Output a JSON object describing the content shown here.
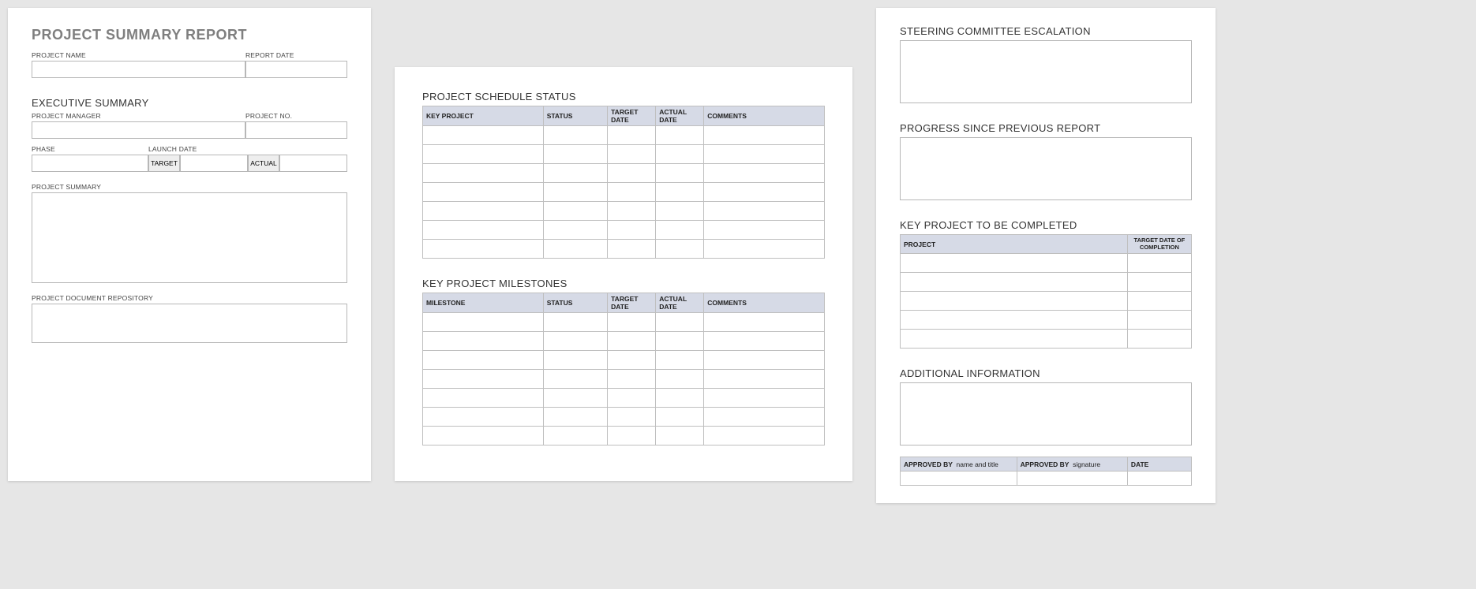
{
  "page1": {
    "title": "PROJECT SUMMARY REPORT",
    "labels": {
      "project_name": "PROJECT NAME",
      "report_date": "REPORT DATE",
      "exec_summary": "EXECUTIVE SUMMARY",
      "project_manager": "PROJECT MANAGER",
      "project_no": "PROJECT NO.",
      "phase": "PHASE",
      "launch_date": "LAUNCH DATE",
      "target": "TARGET",
      "actual": "ACTUAL",
      "project_summary": "PROJECT SUMMARY",
      "doc_repo": "PROJECT DOCUMENT REPOSITORY"
    }
  },
  "page2": {
    "schedule_heading": "PROJECT SCHEDULE STATUS",
    "milestones_heading": "KEY PROJECT MILESTONES",
    "schedule_cols": [
      "KEY PROJECT",
      "STATUS",
      "TARGET DATE",
      "ACTUAL DATE",
      "COMMENTS"
    ],
    "milestone_cols": [
      "MILESTONE",
      "STATUS",
      "TARGET DATE",
      "ACTUAL DATE",
      "COMMENTS"
    ],
    "schedule_rows": 7,
    "milestone_rows": 7
  },
  "page3": {
    "steering_heading": "STEERING COMMITTEE ESCALATION",
    "progress_heading": "PROGRESS SINCE PREVIOUS REPORT",
    "key_project_heading": "KEY PROJECT TO BE COMPLETED",
    "key_project_cols": {
      "project": "PROJECT",
      "target": "TARGET DATE OF COMPLETION"
    },
    "key_project_rows": 5,
    "additional_heading": "ADDITIONAL INFORMATION",
    "approval": {
      "by": "APPROVED BY",
      "name_title": "name and title",
      "signature": "signature",
      "date": "DATE"
    }
  }
}
